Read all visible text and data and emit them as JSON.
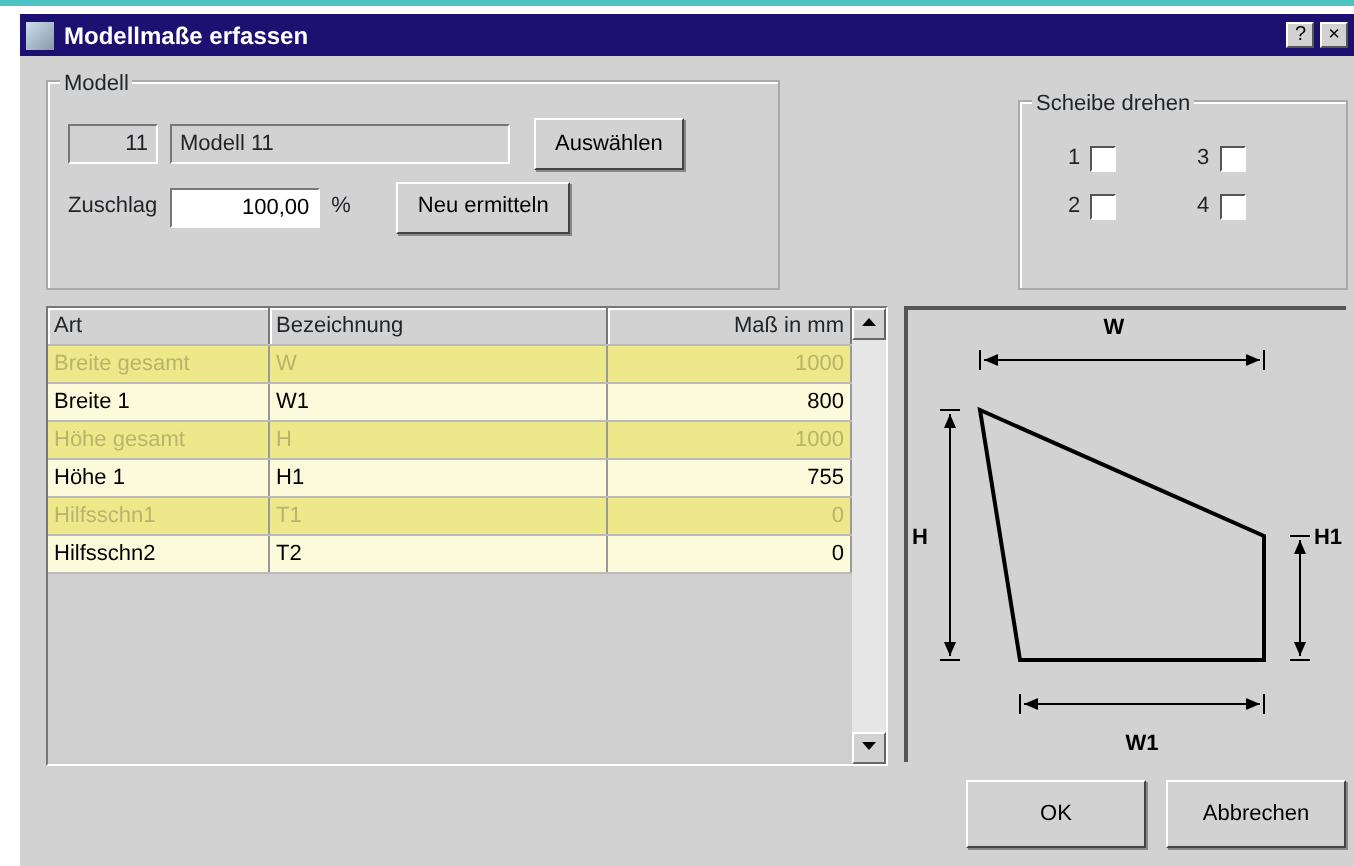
{
  "window": {
    "title": "Modellmaße erfassen",
    "title_buttons": [
      "?",
      "×"
    ]
  },
  "modell": {
    "legend": "Modell",
    "number": "11",
    "name": "Modell 11",
    "select_button": "Auswählen",
    "surcharge_label": "Zuschlag",
    "surcharge_value": "100,00",
    "surcharge_unit": "%",
    "recalc_button": "Neu ermitteln"
  },
  "rotate": {
    "legend": "Scheibe drehen",
    "options": [
      {
        "label": "1",
        "checked": false
      },
      {
        "label": "2",
        "checked": false
      },
      {
        "label": "3",
        "checked": false
      },
      {
        "label": "4",
        "checked": false
      }
    ]
  },
  "table": {
    "columns": [
      "Art",
      "Bezeichnung",
      "Maß in mm"
    ],
    "rows": [
      {
        "cells": [
          "Breite gesamt",
          "W",
          "1000"
        ],
        "disabled": true
      },
      {
        "cells": [
          "Breite 1",
          "W1",
          "800"
        ],
        "disabled": false
      },
      {
        "cells": [
          "Höhe gesamt",
          "H",
          "1000"
        ],
        "disabled": true
      },
      {
        "cells": [
          "Höhe 1",
          "H1",
          "755"
        ],
        "disabled": false
      },
      {
        "cells": [
          "Hilfsschn1",
          "T1",
          "0"
        ],
        "disabled": true
      },
      {
        "cells": [
          "Hilfsschn2",
          "T2",
          "0"
        ],
        "disabled": false
      }
    ]
  },
  "drawing": {
    "labels": [
      "W",
      "H",
      "H1",
      "W1"
    ]
  },
  "buttons": [
    "OK",
    "Abbrechen"
  ]
}
